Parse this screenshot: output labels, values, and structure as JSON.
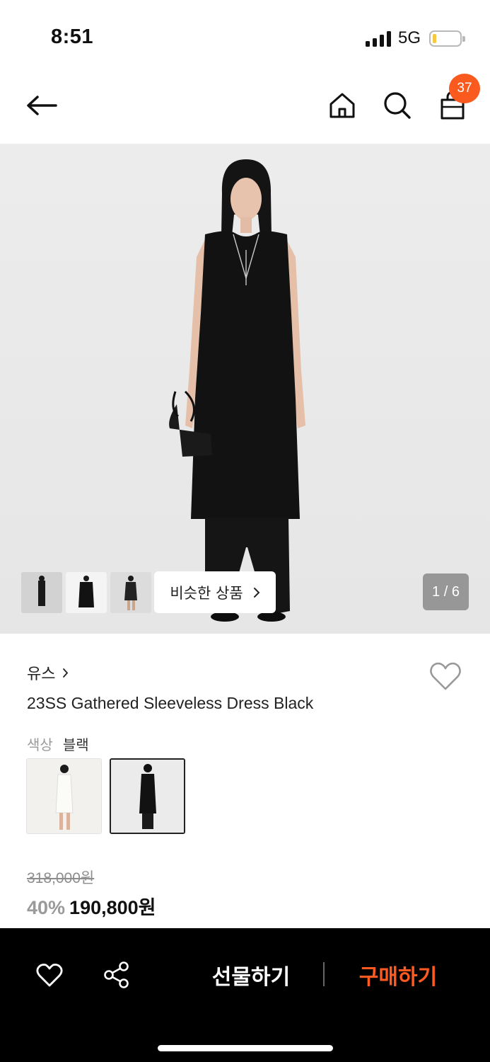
{
  "status_bar": {
    "time": "8:51",
    "network": "5G"
  },
  "nav": {
    "cart_count": "37"
  },
  "hero": {
    "similar_label": "비슷한 상품",
    "pager": "1 / 6"
  },
  "product": {
    "brand": "유스",
    "title": "23SS Gathered Sleeveless Dress Black",
    "color_label": "색상",
    "color_value": "블랙",
    "original_price": "318,000원",
    "discount": "40%",
    "sale_price": "190,800원"
  },
  "bottom": {
    "gift_label": "선물하기",
    "buy_label": "구매하기"
  },
  "icons": [
    "back-arrow-icon",
    "home-icon",
    "search-icon",
    "shopping-bag-icon",
    "chevron-right-icon",
    "heart-icon",
    "share-icon"
  ],
  "colors": {
    "accent": "#fa5a1e",
    "buy_text": "#ff5a1f",
    "bottom_bar": "#000000"
  }
}
